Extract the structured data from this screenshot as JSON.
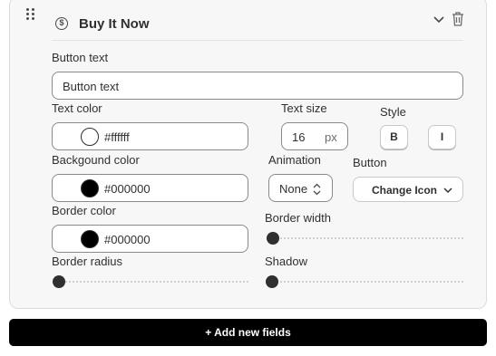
{
  "block": {
    "title": "Buy It Now",
    "title_icon": "dollar-circle-icon"
  },
  "fields": {
    "button_text_label": "Button text",
    "button_text_value": "Button text",
    "text_color_label": "Text color",
    "text_color_value": "#ffffff",
    "text_size_label": "Text size",
    "text_size_value": "16",
    "text_size_unit": "px",
    "style_label": "Style",
    "style_bold": "B",
    "style_italic": "I",
    "bg_color_label": "Backgound color",
    "bg_color_value": "#000000",
    "animation_label": "Animation",
    "animation_value": "None",
    "button_label": "Button",
    "change_icon_label": "Change Icon",
    "border_color_label": "Border color",
    "border_color_value": "#000000",
    "border_width_label": "Border width",
    "border_width_value": 0,
    "border_radius_label": "Border radius",
    "border_radius_value": 0,
    "shadow_label": "Shadow",
    "shadow_value": 0
  },
  "footer": {
    "add_fields_label": "+ Add new fields"
  },
  "colors": {
    "swatch_text": "#ffffff",
    "swatch_bg": "#000000",
    "swatch_border": "#000000",
    "primary_button": "#000000"
  }
}
